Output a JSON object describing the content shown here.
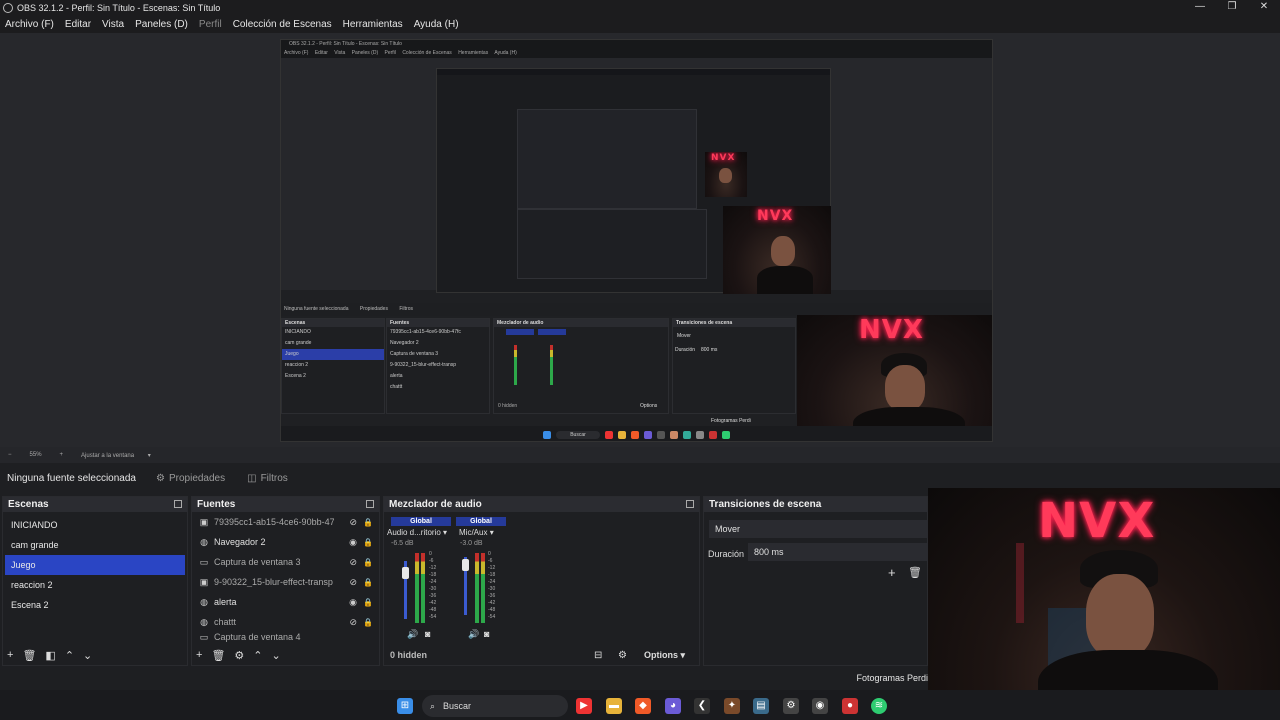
{
  "window": {
    "title": "OBS 32.1.2 - Perfil: Sin Título - Escenas: Sin Título",
    "controls": [
      "—",
      "❐",
      "✕"
    ]
  },
  "menu": [
    {
      "label": "Archivo (F)",
      "enabled": true
    },
    {
      "label": "Editar",
      "enabled": true
    },
    {
      "label": "Vista",
      "enabled": true
    },
    {
      "label": "Paneles (D)",
      "enabled": true
    },
    {
      "label": "Perfil",
      "enabled": false
    },
    {
      "label": "Colección de Escenas",
      "enabled": true
    },
    {
      "label": "Herramientas",
      "enabled": true
    },
    {
      "label": "Ayuda (H)",
      "enabled": true
    }
  ],
  "preview": {
    "inner_title": "OBS 32.1.2 - Perfil: Sin Título - Escenas: Sin Título",
    "inner_menu": [
      "Archivo (F)",
      "Editar",
      "Vista",
      "Paneles (D)",
      "Perfil",
      "Colección de Escenas",
      "Herramientas",
      "Ayuda (H)"
    ],
    "inner_source_label": "Ninguna fuente seleccionada",
    "inner_props": "Propiedades",
    "inner_filters": "Filtros",
    "inner_scenes_title": "Escenas",
    "inner_sources_title": "Fuentes",
    "inner_mixer_title": "Mezclador de audio",
    "inner_trans_title": "Transiciones de escena",
    "inner_trans_value": "Mover",
    "inner_dur_label": "Duración",
    "inner_dur_value": "800 ms",
    "inner_hidden": "0 hidden",
    "inner_options": "Options",
    "inner_frames": "Fotogramas Perdi",
    "inner_search": "Buscar",
    "inner_scenes": [
      "INICIANDO",
      "cam grande",
      "Juego",
      "reaccion 2",
      "Escena 2"
    ],
    "inner_sources": [
      "79395cc1-ab15-4ce6-90bb-47fc",
      "Navegador 2",
      "Captura de ventana 3",
      "9-90322_15-blur-effect-transp",
      "alerta",
      "chattt"
    ],
    "logo_text": "NVX"
  },
  "zoombar": {
    "zoom": "55%",
    "fit": "Ajustar a la ventana"
  },
  "source_toolbar": {
    "no_source": "Ninguna fuente seleccionada",
    "properties": "Propiedades",
    "filters": "Filtros"
  },
  "scenes": {
    "title": "Escenas",
    "items": [
      {
        "label": "INICIANDO",
        "selected": false
      },
      {
        "label": "cam grande",
        "selected": false
      },
      {
        "label": "Juego",
        "selected": true
      },
      {
        "label": "reaccion 2",
        "selected": false
      },
      {
        "label": "Escena 2",
        "selected": false
      }
    ]
  },
  "sources": {
    "title": "Fuentes",
    "items": [
      {
        "label": "79395cc1-ab15-4ce6-90bb-47fc",
        "icon": "image-icon",
        "visible": false
      },
      {
        "label": "Navegador 2",
        "icon": "globe-icon",
        "visible": true
      },
      {
        "label": "Captura de ventana 3",
        "icon": "window-icon",
        "visible": false
      },
      {
        "label": "9-90322_15-blur-effect-transp",
        "icon": "image-icon",
        "visible": false
      },
      {
        "label": "alerta",
        "icon": "globe-icon",
        "visible": true
      },
      {
        "label": "chattt",
        "icon": "globe-icon",
        "visible": false
      },
      {
        "label": "Captura de ventana 4",
        "icon": "window-icon",
        "visible": false
      }
    ]
  },
  "mixer": {
    "title": "Mezclador de audio",
    "channels": [
      {
        "global": "Global",
        "name": "Audio d...ritorio",
        "db": "-6.5 dB"
      },
      {
        "global": "Global",
        "name": "Mic/Aux",
        "db": "-3.0 dB"
      }
    ],
    "scale": [
      "0",
      "-6",
      "-12",
      "-18",
      "-24",
      "-30",
      "-36",
      "-42",
      "-48",
      "-54",
      "-60"
    ],
    "hidden": "0 hidden",
    "options": "Options"
  },
  "transitions": {
    "title": "Transiciones de escena",
    "selected": "Mover",
    "duration_label": "Duración",
    "duration_value": "800 ms"
  },
  "status": {
    "frames": "Fotogramas Perdi"
  },
  "webcam": {
    "logo_text": "NVX"
  },
  "taskbar": {
    "search": "Buscar"
  },
  "colors": {
    "accent": "#2a45c4",
    "bg": "#1e1f22",
    "neon": "#ff3a5a"
  }
}
